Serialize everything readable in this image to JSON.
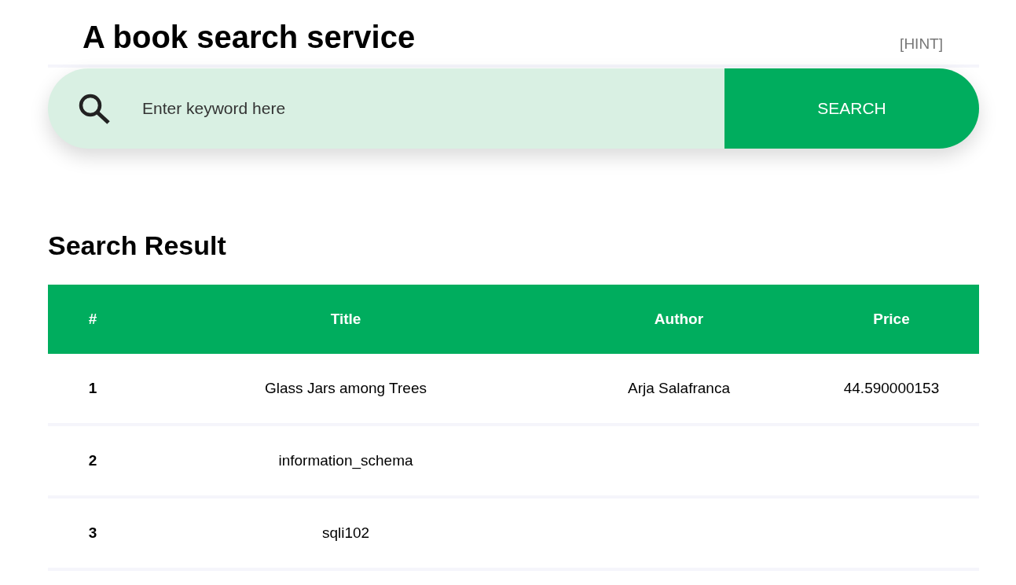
{
  "header": {
    "title": "A book search service",
    "hint_link": "[HINT]"
  },
  "search": {
    "placeholder": "Enter keyword here",
    "button": "SEARCH"
  },
  "results": {
    "heading": "Search Result",
    "columns": [
      "#",
      "Title",
      "Author",
      "Price"
    ],
    "rows": [
      {
        "number": "1",
        "title": "Glass Jars among Trees",
        "author": "Arja Salafranca",
        "price": "44.590000153"
      },
      {
        "number": "2",
        "title": "information_schema"
      },
      {
        "number": "3",
        "title": "sqli102"
      }
    ]
  }
}
